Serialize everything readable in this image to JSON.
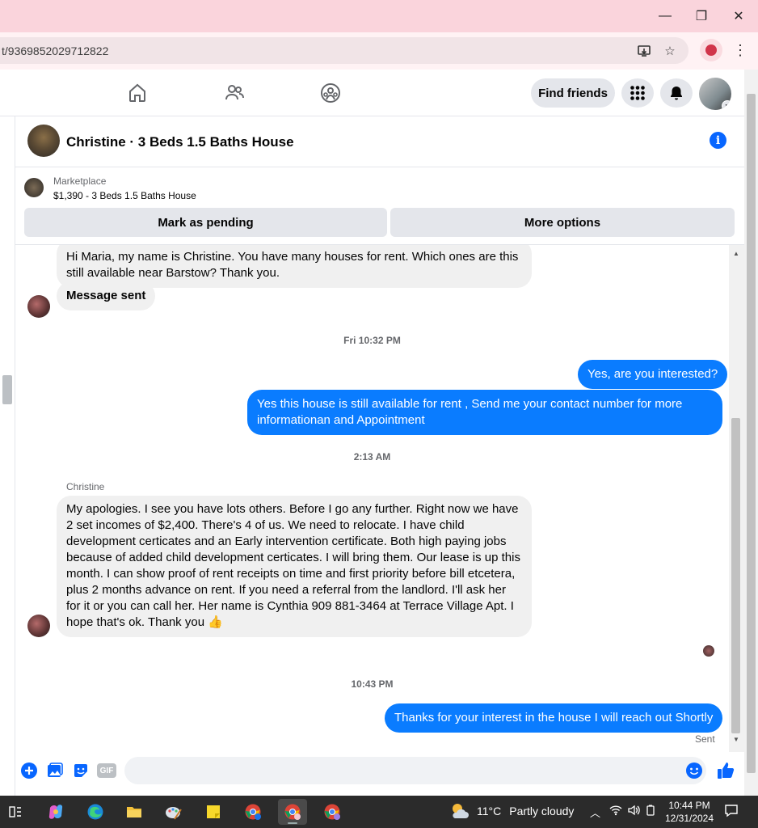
{
  "browser": {
    "url": "t/9369852029712822",
    "window_controls": {
      "minimize": "—",
      "maximize": "❐",
      "close": "✕"
    }
  },
  "nav": {
    "find_friends": "Find friends"
  },
  "chat": {
    "title": "Christine · 3 Beds 1.5 Baths House",
    "marketplace_label": "Marketplace",
    "marketplace_item": "$1,390 - 3 Beds 1.5 Baths House",
    "mark_pending": "Mark as pending",
    "more_options": "More options"
  },
  "messages": {
    "m1": "Hi Maria, my name is Christine. You have many houses for rent. Which ones are this still available near Barstow? Thank you.",
    "m2": "Message sent",
    "ts1": "Fri 10:32 PM",
    "m3": "Yes, are you interested?",
    "m4": "Yes this house is still available for rent , Send me your contact number for more informationan and Appointment",
    "ts2": "2:13 AM",
    "sender_name": "Christine",
    "m5": "My apologies. I see you have lots others. Before I go any further. Right now we have 2 set incomes of $2,400. There's 4 of us. We need to relocate. I have child development certicates and an Early intervention certificate. Both high paying jobs because of added child development certicates. I will bring them. Our lease is up this month. I can show proof of rent receipts on time and first priority before bill etcetera, plus 2 months advance on rent. If you need a referral from the landlord. I'll ask her for it or you can call her. Her name is Cynthia  909 881-3464 at Terrace Village Apt. I hope that's ok. Thank you 👍",
    "ts3": "10:43 PM",
    "m6": "Thanks for your interest in the house I will reach out Shortly",
    "sent_label": "Sent"
  },
  "composer": {
    "gif_label": "GIF",
    "input_value": ""
  },
  "taskbar": {
    "temperature": "11°C",
    "condition": "Partly cloudy",
    "time": "10:44 PM",
    "date": "12/31/2024"
  },
  "colors": {
    "accent": "#0866ff",
    "outgoing_bubble": "#0a7cff",
    "incoming_bubble": "#f0f0f0",
    "titlebar": "#fad4dc"
  }
}
